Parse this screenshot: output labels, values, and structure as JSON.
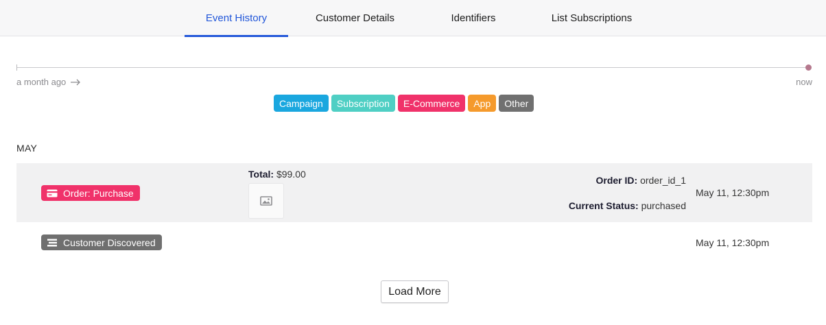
{
  "tabs": [
    {
      "label": "Event History",
      "active": true
    },
    {
      "label": "Customer Details",
      "active": false
    },
    {
      "label": "Identifiers",
      "active": false
    },
    {
      "label": "List Subscriptions",
      "active": false
    }
  ],
  "timeline": {
    "start_label": "a month ago",
    "end_label": "now"
  },
  "legend": [
    {
      "label": "Campaign",
      "color": "#1aa7df"
    },
    {
      "label": "Subscription",
      "color": "#4fcfc4"
    },
    {
      "label": "E-Commerce",
      "color": "#f0326a"
    },
    {
      "label": "App",
      "color": "#f59a2c"
    },
    {
      "label": "Other",
      "color": "#707070"
    }
  ],
  "month_header": "MAY",
  "events": [
    {
      "badge": "Order: Purchase",
      "badge_color": "#f0326a",
      "badge_icon": "credit-card-icon",
      "total_label": "Total:",
      "total_value": "$99.00",
      "image_icon": "image-icon",
      "order_id_label": "Order ID:",
      "order_id_value": "order_id_1",
      "status_label": "Current Status:",
      "status_value": "purchased",
      "timestamp": "May 11, 12:30pm"
    },
    {
      "badge": "Customer Discovered",
      "badge_color": "#6f6f6f",
      "badge_icon": "list-icon",
      "timestamp": "May 11, 12:30pm"
    }
  ],
  "load_more_label": "Load More"
}
